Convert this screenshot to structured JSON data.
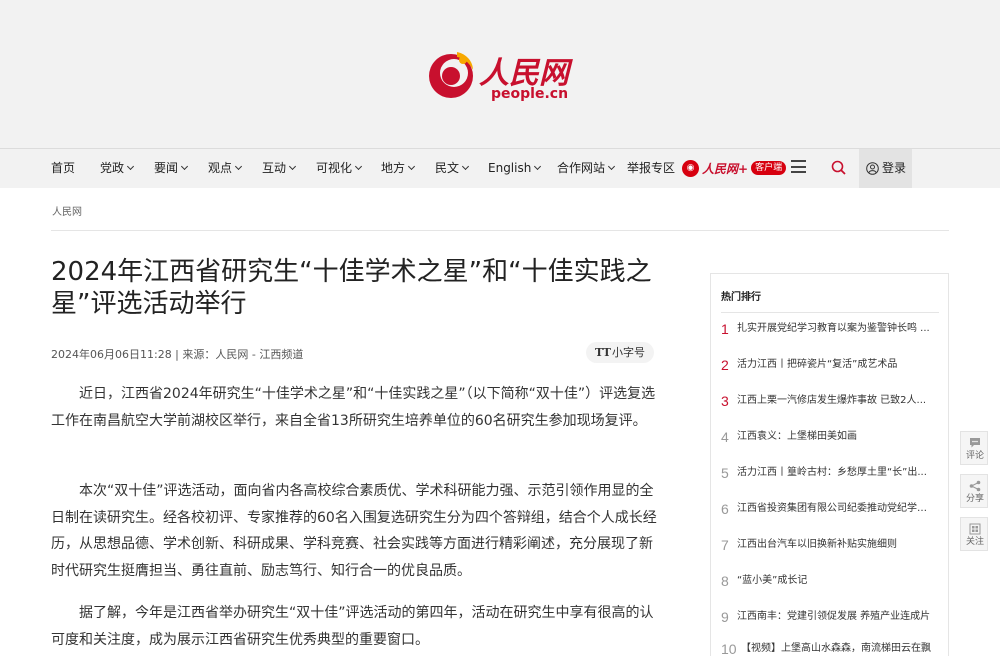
{
  "header": {
    "brand_cn": "人民网",
    "brand_en": "people.cn"
  },
  "nav": {
    "items": [
      {
        "label": "首页",
        "has_caret": false
      },
      {
        "label": "党政",
        "has_caret": true
      },
      {
        "label": "要闻",
        "has_caret": true
      },
      {
        "label": "观点",
        "has_caret": true
      },
      {
        "label": "互动",
        "has_caret": true
      },
      {
        "label": "可视化",
        "has_caret": true
      },
      {
        "label": "地方",
        "has_caret": true
      },
      {
        "label": "民文",
        "has_caret": true
      },
      {
        "label": "English",
        "has_caret": true
      },
      {
        "label": "合作网站",
        "has_caret": true
      },
      {
        "label": "举报专区",
        "has_caret": false
      }
    ],
    "app_link": {
      "name": "人民网+",
      "badge": "客户端"
    },
    "login_label": "登录"
  },
  "breadcrumb": {
    "label": "人民网"
  },
  "article": {
    "title": "2024年江西省研究生“十佳学术之星”和“十佳实践之星”评选活动举行",
    "meta": "2024年06月06日11:28 | 来源：人民网 - 江西频道",
    "font_toggle": {
      "icon": "TT",
      "label": "小字号"
    },
    "paragraphs": [
      "近日，江西省2024年研究生“十佳学术之星”和“十佳实践之星”（以下简称“双十佳”）评选复选工作在南昌航空大学前湖校区举行，来自全省13所研究生培养单位的60名研究生参加现场复评。",
      "本次“双十佳”评选活动，面向省内各高校综合素质优、学术科研能力强、示范引领作用显的全日制在读研究生。经各校初评、专家推荐的60名入围复选研究生分为四个答辩组，结合个人成长经历，从思想品德、学术创新、科研成果、学科竞赛、社会实践等方面进行精彩阐述，充分展现了新时代研究生挺膺担当、勇往直前、励志笃行、知行合一的优良品质。",
      "据了解，今年是江西省举办研究生“双十佳”评选活动的第四年，活动在研究生中享有很高的认可度和关注度，成为展示江西省研究生优秀典型的重要窗口。"
    ]
  },
  "hot_list": {
    "title": "热门排行",
    "items": [
      {
        "rank": "1",
        "text": "扎实开展党纪学习教育以案为鉴警钟长鸣 ..."
      },
      {
        "rank": "2",
        "text": "活力江西丨把碎瓷片“复活”成艺术品"
      },
      {
        "rank": "3",
        "text": "江西上栗一汽修店发生爆炸事故 已致2人..."
      },
      {
        "rank": "4",
        "text": "江西袁义：上堡梯田美如画"
      },
      {
        "rank": "5",
        "text": "活力江西丨篁岭古村：乡愁厚土里“长”出..."
      },
      {
        "rank": "6",
        "text": "江西省投资集团有限公司纪委推动党纪学习..."
      },
      {
        "rank": "7",
        "text": "江西出台汽车以旧换新补贴实施细则"
      },
      {
        "rank": "8",
        "text": "“蓝小美”成长记"
      },
      {
        "rank": "9",
        "text": "江西南丰：党建引领促发展 养殖产业连成片"
      },
      {
        "rank": "10",
        "text": "【视频】上堡高山水森森，南流梯田云在飘"
      }
    ]
  },
  "side_tools": [
    {
      "label": "评论",
      "icon": "comment-icon"
    },
    {
      "label": "分享",
      "icon": "share-icon"
    },
    {
      "label": "关注",
      "icon": "follow-icon"
    }
  ],
  "colors": {
    "brand_red": "#c8102e",
    "rank_red": "#c8102e",
    "header_bg": "#f2f2f2"
  }
}
